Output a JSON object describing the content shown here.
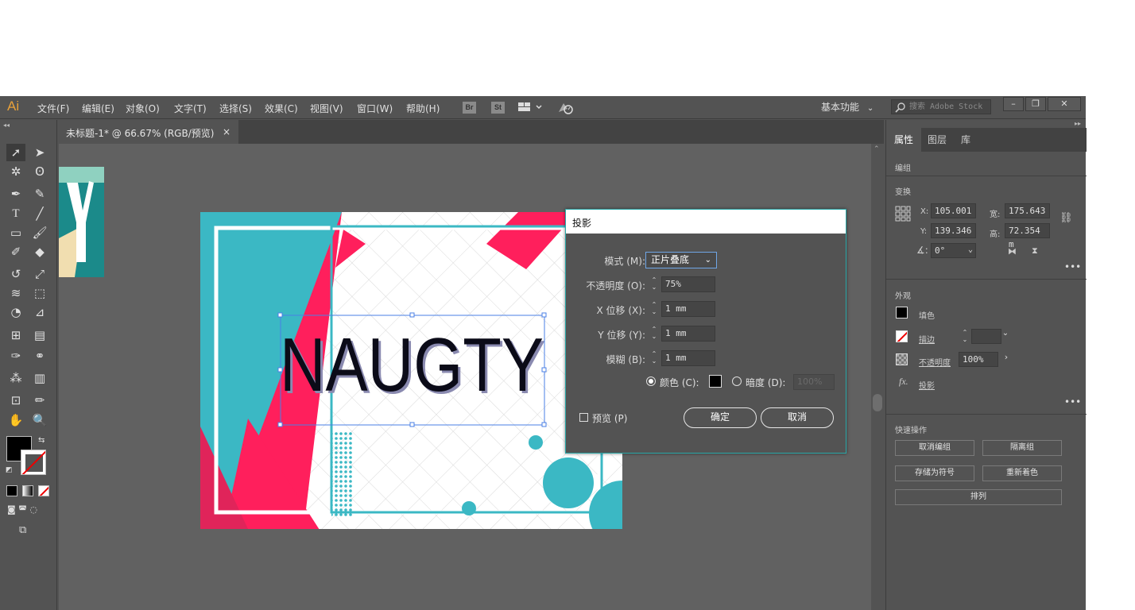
{
  "app": {
    "logo": "Ai"
  },
  "menu": [
    "文件(F)",
    "编辑(E)",
    "对象(O)",
    "文字(T)",
    "选择(S)",
    "效果(C)",
    "视图(V)",
    "窗口(W)",
    "帮助(H)"
  ],
  "bridge": {
    "br": "Br",
    "st": "St"
  },
  "workspace": "基本功能",
  "stock_placeholder": "搜索 Adobe Stock",
  "document_tab": {
    "title": "未标题-1* @ 66.67% (RGB/预览)",
    "close": "×"
  },
  "artwork": {
    "text": "NAUGTY"
  },
  "dialog": {
    "title": "投影",
    "mode_label": "模式 (M):",
    "mode_value": "正片叠底",
    "opacity_label": "不透明度 (O):",
    "opacity_value": "75%",
    "x_label": "X 位移 (X):",
    "x_value": "1 mm",
    "y_label": "Y 位移 (Y):",
    "y_value": "1 mm",
    "blur_label": "模糊 (B):",
    "blur_value": "1 mm",
    "color_label": "颜色 (C):",
    "darkness_label": "暗度 (D):",
    "darkness_value": "100%",
    "preview_label": "预览 (P)",
    "ok": "确定",
    "cancel": "取消"
  },
  "right_panel": {
    "tabs": [
      "属性",
      "图层",
      "库"
    ],
    "group": "编组",
    "transform": "变换",
    "x_label": "X:",
    "x_value": "105.001",
    "y_label": "Y:",
    "y_value": "139.346",
    "w_label": "宽:",
    "w_value": "175.643",
    "h_label": "高:",
    "h_value": "72.354 m",
    "angle_value": "0°",
    "appearance": "外观",
    "fill": "填色",
    "stroke": "描边",
    "opacity_label": "不透明度",
    "opacity_value": "100%",
    "effect": "投影",
    "quick_actions": "快速操作",
    "qa_buttons": [
      "取消编组",
      "隔离组",
      "存储为符号",
      "重新着色",
      "排列"
    ]
  }
}
